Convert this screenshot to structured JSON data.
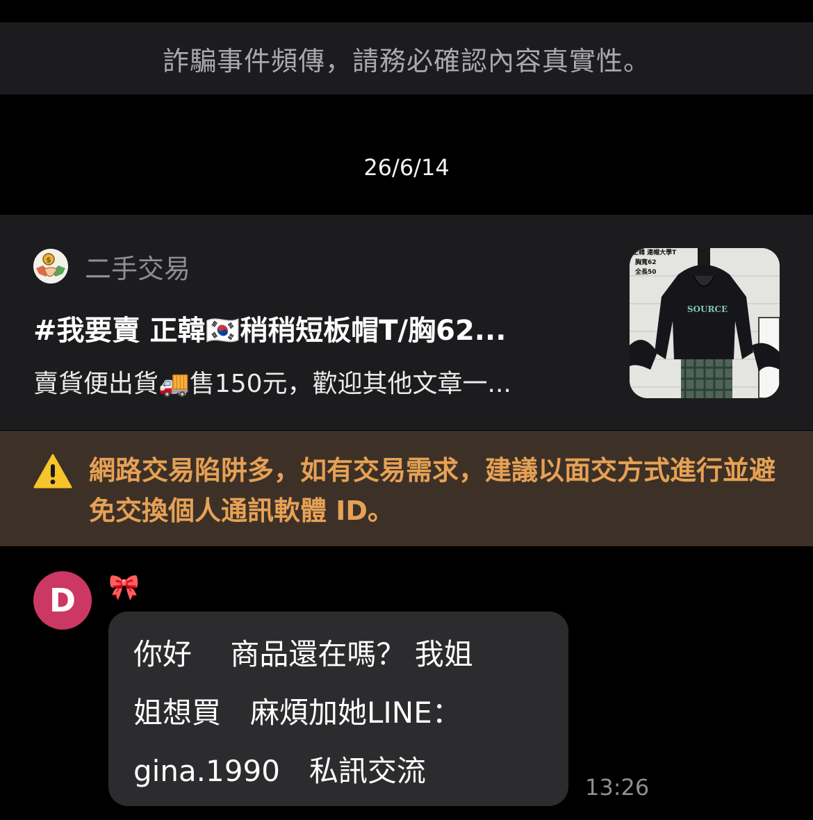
{
  "scam_banner": "詐騙事件頻傳，請務必確認內容真實性。",
  "date_separator": "26/6/14",
  "post": {
    "group_icon": "handshake-money-icon",
    "group_name": "二手交易",
    "title": "#我要賣 正韓🇰🇷稍稍短板帽T/胸62...",
    "description": "賣貨便出貨🚚售150元，歡迎其他文章一...",
    "thumbnail": {
      "icon": "hoodie-product-photo",
      "caption_lines": [
        "正韓 連帽大學T",
        "胸寬62",
        "全長50"
      ],
      "print_text": "SOURCE"
    }
  },
  "warning": {
    "icon": "warning-icon",
    "text": "網路交易陷阱多，如有交易需求，建議以面交方式進行並避免交換個人通訊軟體 ID。"
  },
  "message": {
    "avatar_letter": "D",
    "sender_name": "🎀",
    "text": "你好　 商品還在嗎？ 我姐\n姐想買　麻煩加她LINE：\ngina.1990　私訊交流",
    "time": "13:26"
  },
  "colors": {
    "background": "#000000",
    "card": "#1c1c1e",
    "bubble": "#2c2c2e",
    "warning_bg": "#3d3127",
    "warning_text": "#e6a155",
    "avatar": "#cc3864"
  }
}
